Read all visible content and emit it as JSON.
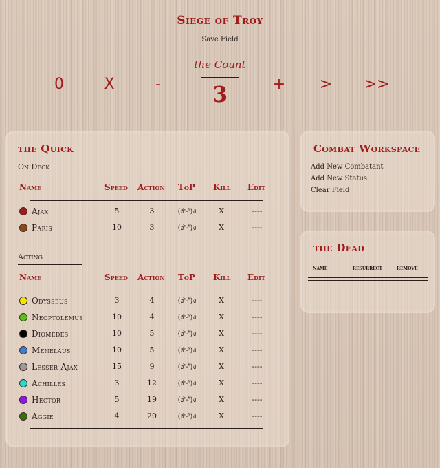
{
  "header": {
    "title": "Siege of Troy",
    "save_field": "Save Field"
  },
  "count": {
    "label": "the Count",
    "value": "3",
    "controls": [
      "0",
      "X",
      "-",
      "+",
      ">",
      ">>"
    ]
  },
  "quick": {
    "title": "the Quick",
    "on_deck_label": "On Deck",
    "acting_label": "Acting",
    "columns": {
      "name": "Name",
      "speed": "Speed",
      "action": "Action",
      "top": "ToP",
      "kill": "Kill",
      "edit": "Edit"
    },
    "on_deck": [
      {
        "name": "Ajax",
        "speed": "5",
        "action": "3",
        "top": "(ง'̀-'́)ง",
        "kill": "X",
        "edit": "----",
        "color": "#a01c1c"
      },
      {
        "name": "Paris",
        "speed": "10",
        "action": "3",
        "top": "(ง'̀-'́)ง",
        "kill": "X",
        "edit": "----",
        "color": "#8b4a1e"
      }
    ],
    "acting": [
      {
        "name": "Odysseus",
        "speed": "3",
        "action": "4",
        "top": "(ง'̀-'́)ง",
        "kill": "X",
        "edit": "----",
        "color": "#f2e600"
      },
      {
        "name": "Neoptolemus",
        "speed": "10",
        "action": "4",
        "top": "(ง'̀-'́)ง",
        "kill": "X",
        "edit": "----",
        "color": "#5cc21a"
      },
      {
        "name": "Diomedes",
        "speed": "10",
        "action": "5",
        "top": "(ง'̀-'́)ง",
        "kill": "X",
        "edit": "----",
        "color": "#000000"
      },
      {
        "name": "Menelaus",
        "speed": "10",
        "action": "5",
        "top": "(ง'̀-'́)ง",
        "kill": "X",
        "edit": "----",
        "color": "#3a7ed8"
      },
      {
        "name": "Lesser Ajax",
        "speed": "15",
        "action": "9",
        "top": "(ง'̀-'́)ง",
        "kill": "X",
        "edit": "----",
        "color": "#9a9a9a"
      },
      {
        "name": "Achilles",
        "speed": "3",
        "action": "12",
        "top": "(ง'̀-'́)ง",
        "kill": "X",
        "edit": "----",
        "color": "#2ed8c8"
      },
      {
        "name": "Hector",
        "speed": "5",
        "action": "19",
        "top": "(ง'̀-'́)ง",
        "kill": "X",
        "edit": "----",
        "color": "#8a1ae0"
      },
      {
        "name": "Aggie",
        "speed": "4",
        "action": "20",
        "top": "(ง'̀-'́)ง",
        "kill": "X",
        "edit": "----",
        "color": "#3c6e12"
      }
    ]
  },
  "workspace": {
    "title": "Combat Workspace",
    "links": [
      "Add New Combatant",
      "Add New Status",
      "Clear Field"
    ]
  },
  "dead": {
    "title": "the Dead",
    "columns": {
      "name": "name",
      "resurrect": "resurrect",
      "remove": "remove"
    }
  }
}
